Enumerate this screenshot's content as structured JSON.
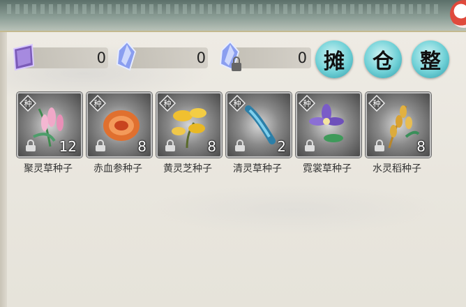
{
  "currencies": [
    {
      "icon": "purple-talisman-icon",
      "value": "0"
    },
    {
      "icon": "spirit-crystal-icon",
      "value": "0"
    },
    {
      "icon": "locked-spirit-crystal-icon",
      "value": "0"
    }
  ],
  "actions": [
    {
      "id": "stall",
      "label": "摊"
    },
    {
      "id": "warehouse",
      "label": "仓"
    },
    {
      "id": "sort",
      "label": "整"
    }
  ],
  "items": [
    {
      "name": "聚灵草种子",
      "count": "12",
      "badge": "种",
      "icon": "juling-herb-icon"
    },
    {
      "name": "赤血参种子",
      "count": "8",
      "badge": "种",
      "icon": "red-mushroom-icon"
    },
    {
      "name": "黄灵芝种子",
      "count": "8",
      "badge": "种",
      "icon": "yellow-lingzhi-icon"
    },
    {
      "name": "清灵草种子",
      "count": "2",
      "badge": "种",
      "icon": "blue-herb-icon"
    },
    {
      "name": "霓裳草种子",
      "count": "",
      "badge": "种",
      "icon": "purple-flower-icon"
    },
    {
      "name": "水灵稻种子",
      "count": "8",
      "badge": "种",
      "icon": "rice-stalk-icon"
    }
  ],
  "colors": {
    "action_button": "#6fd0d6",
    "topbar": "#8fa199",
    "background": "#ece9e1"
  }
}
